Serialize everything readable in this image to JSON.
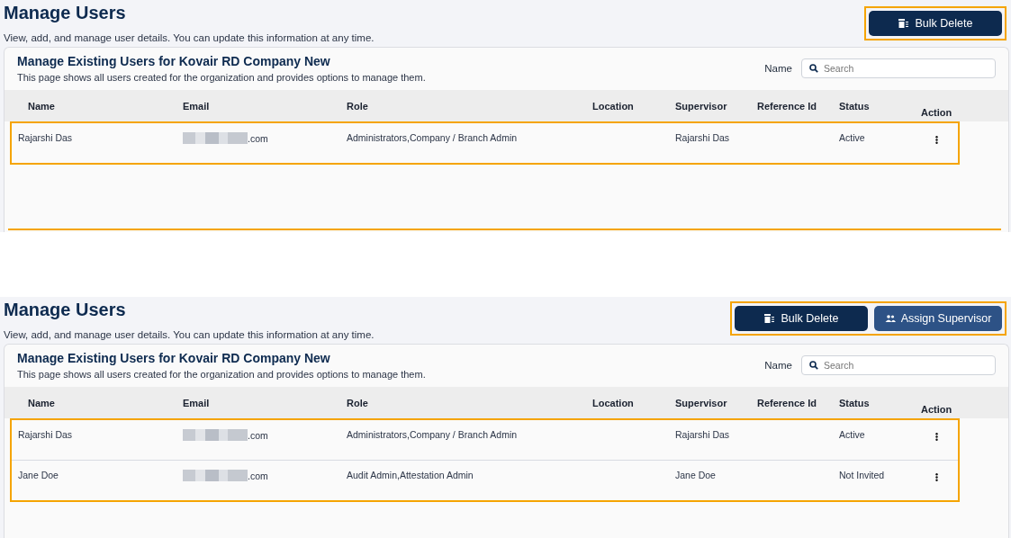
{
  "panels": [
    {
      "title": "Manage Users",
      "subtitle": "View, add, and manage user details. You can update this information at any time.",
      "actions_highlighted": true,
      "actions": [
        {
          "kind": "delete",
          "label": "Bulk Delete"
        }
      ],
      "card": {
        "title": "Manage Existing Users for Kovair RD Company New",
        "subtitle": "This page shows all users created for the organization and provides options to manage them.",
        "filter_label": "Name",
        "search": {
          "placeholder": "Search"
        }
      },
      "columns": [
        "Name",
        "Email",
        "Role",
        "Location",
        "Supervisor",
        "Reference Id",
        "Status",
        "Action"
      ],
      "rows_highlighted": true,
      "bottom_rule_highlighted": true,
      "rows": [
        {
          "name": "Rajarshi Das",
          "email": ".com",
          "role": "Administrators,Company / Branch Admin",
          "location": "",
          "supervisor": "Rajarshi Das",
          "reference_id": "",
          "status": "Active"
        }
      ]
    },
    {
      "title": "Manage Users",
      "subtitle": "View, add, and manage user details. You can update this information at any time.",
      "actions_highlighted": true,
      "actions": [
        {
          "kind": "delete",
          "label": "Bulk Delete"
        },
        {
          "kind": "supervisor",
          "label": "Assign Supervisor"
        }
      ],
      "card": {
        "title": "Manage Existing Users for Kovair RD Company New",
        "subtitle": "This page shows all users created for the organization and provides options to manage them.",
        "filter_label": "Name",
        "search": {
          "placeholder": "Search"
        }
      },
      "columns": [
        "Name",
        "Email",
        "Role",
        "Location",
        "Supervisor",
        "Reference Id",
        "Status",
        "Action"
      ],
      "rows_highlighted": true,
      "rows": [
        {
          "name": "Rajarshi Das",
          "email": ".com",
          "role": "Administrators,Company / Branch Admin",
          "location": "",
          "supervisor": "Rajarshi Das",
          "reference_id": "",
          "status": "Active"
        },
        {
          "name": "Jane Doe",
          "email": ".com",
          "role": "Audit Admin,Attestation Admin",
          "location": "",
          "supervisor": "Jane Doe",
          "reference_id": "",
          "status": "Not Invited"
        }
      ]
    }
  ]
}
